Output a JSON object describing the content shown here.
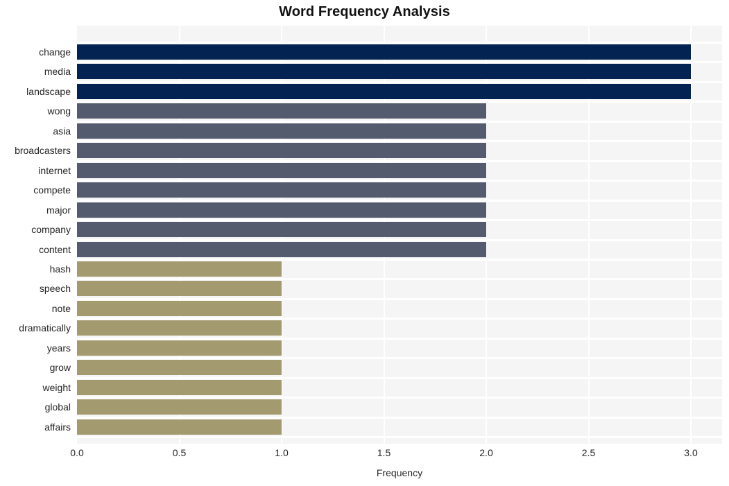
{
  "chart_data": {
    "type": "bar",
    "orientation": "horizontal",
    "title": "Word Frequency Analysis",
    "xlabel": "Frequency",
    "ylabel": "",
    "xlim": [
      0.0,
      3.0
    ],
    "xticks": [
      "0.0",
      "0.5",
      "1.0",
      "1.5",
      "2.0",
      "2.5",
      "3.0"
    ],
    "xtick_values": [
      0.0,
      0.5,
      1.0,
      1.5,
      2.0,
      2.5,
      3.0
    ],
    "grid": true,
    "legend": "none",
    "categories": [
      "change",
      "media",
      "landscape",
      "wong",
      "asia",
      "broadcasters",
      "internet",
      "compete",
      "major",
      "company",
      "content",
      "hash",
      "speech",
      "note",
      "dramatically",
      "years",
      "grow",
      "weight",
      "global",
      "affairs"
    ],
    "values": [
      3,
      3,
      3,
      2,
      2,
      2,
      2,
      2,
      2,
      2,
      2,
      1,
      1,
      1,
      1,
      1,
      1,
      1,
      1,
      1
    ],
    "bar_colors": [
      "#032452",
      "#032452",
      "#032452",
      "#555b6e",
      "#555b6e",
      "#555b6e",
      "#555b6e",
      "#555b6e",
      "#555b6e",
      "#555b6e",
      "#555b6e",
      "#a39a6f",
      "#a39a6f",
      "#a39a6f",
      "#a39a6f",
      "#a39a6f",
      "#a39a6f",
      "#a39a6f",
      "#a39a6f",
      "#a39a6f"
    ]
  },
  "style": {
    "plot_background": "#f5f5f5",
    "figure_background": "#ffffff",
    "grid_color": "#ffffff",
    "text_color": "#262626",
    "title_color": "#111111"
  }
}
